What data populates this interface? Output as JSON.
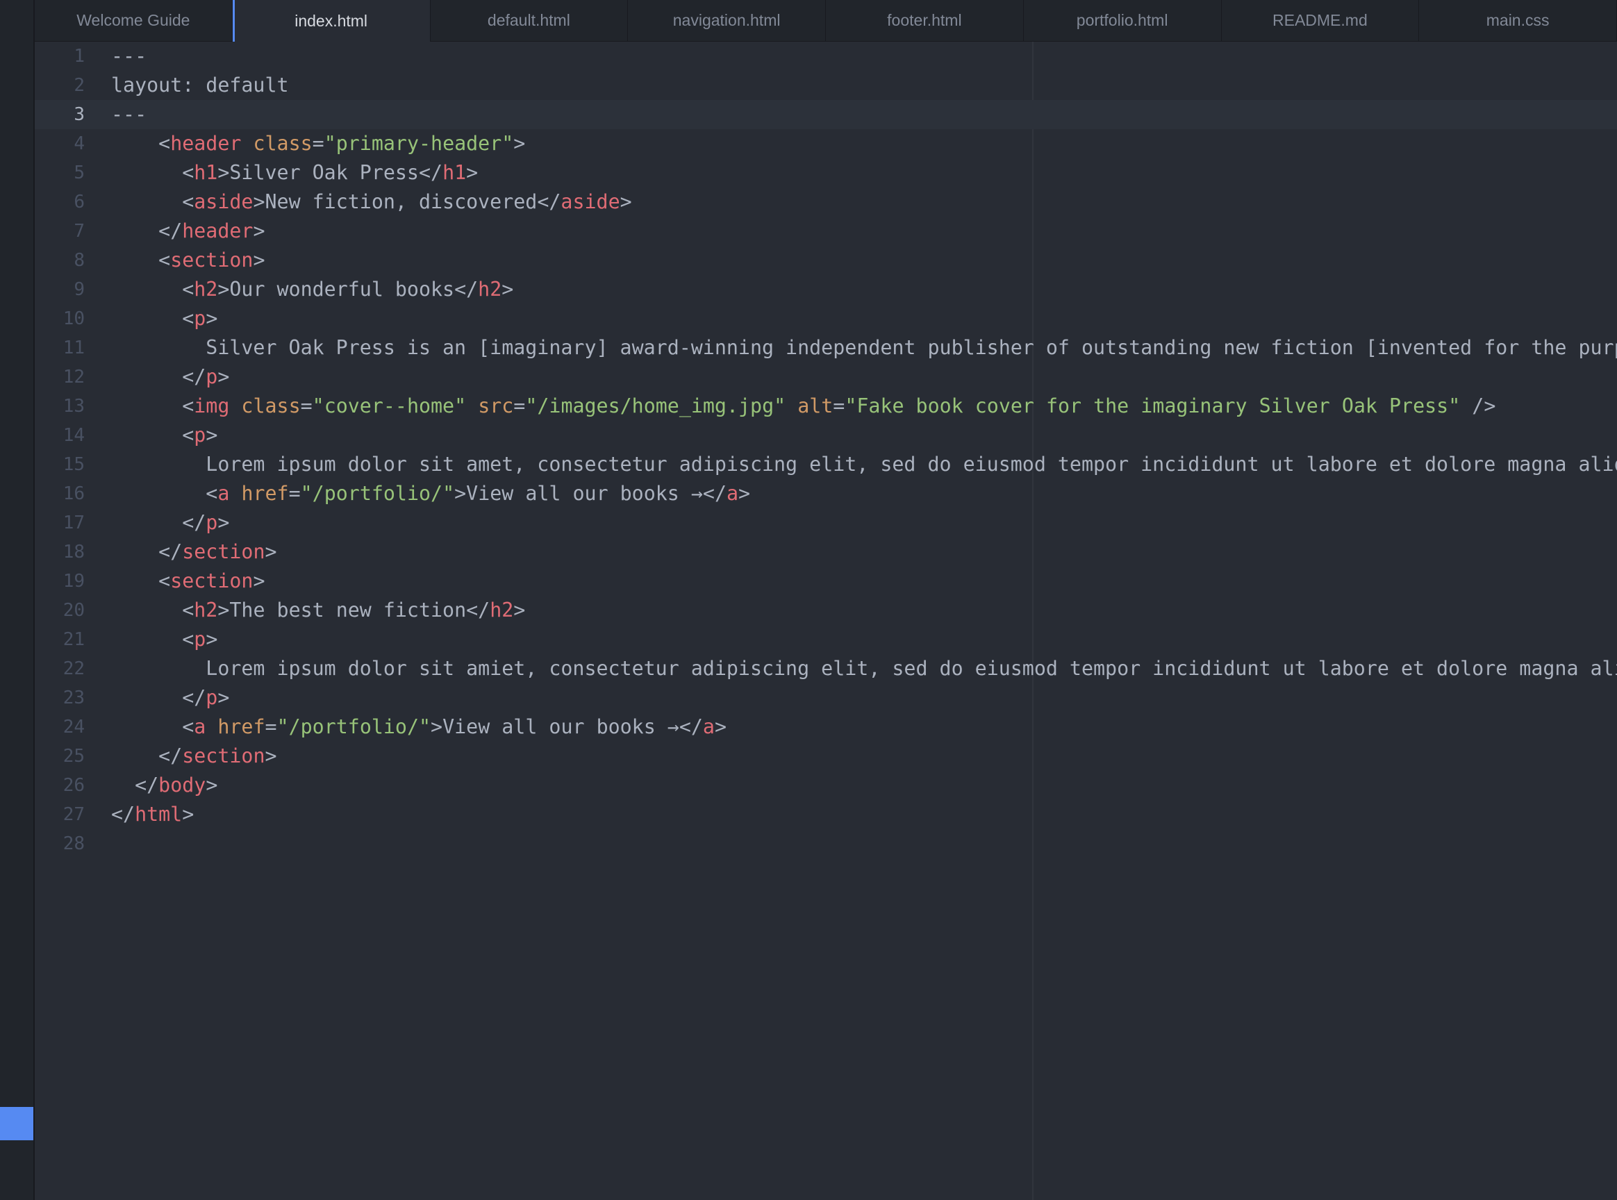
{
  "window": {
    "accent_color": "#568af2",
    "background_color": "#282c34"
  },
  "tabs": [
    {
      "label": "Welcome Guide",
      "active": false
    },
    {
      "label": "index.html",
      "active": true
    },
    {
      "label": "default.html",
      "active": false
    },
    {
      "label": "navigation.html",
      "active": false
    },
    {
      "label": "footer.html",
      "active": false
    },
    {
      "label": "portfolio.html",
      "active": false
    },
    {
      "label": "README.md",
      "active": false
    },
    {
      "label": "main.css",
      "active": false
    }
  ],
  "editor": {
    "cursor_line": 3,
    "lines": [
      {
        "num": "1",
        "tokens": [
          [
            "dash",
            "---"
          ]
        ]
      },
      {
        "num": "2",
        "tokens": [
          [
            "text",
            "layout: default"
          ]
        ]
      },
      {
        "num": "3",
        "tokens": [
          [
            "dash",
            "---"
          ]
        ]
      },
      {
        "num": "4",
        "tokens": [
          [
            "text",
            "    "
          ],
          [
            "punct",
            "<"
          ],
          [
            "tag",
            "header"
          ],
          [
            "text",
            " "
          ],
          [
            "attr",
            "class"
          ],
          [
            "punct",
            "="
          ],
          [
            "str",
            "\"primary-header\""
          ],
          [
            "punct",
            ">"
          ]
        ]
      },
      {
        "num": "5",
        "tokens": [
          [
            "text",
            "      "
          ],
          [
            "punct",
            "<"
          ],
          [
            "tag",
            "h1"
          ],
          [
            "punct",
            ">"
          ],
          [
            "text",
            "Silver Oak Press"
          ],
          [
            "punct",
            "</"
          ],
          [
            "tag",
            "h1"
          ],
          [
            "punct",
            ">"
          ]
        ]
      },
      {
        "num": "6",
        "tokens": [
          [
            "text",
            "      "
          ],
          [
            "punct",
            "<"
          ],
          [
            "tag",
            "aside"
          ],
          [
            "punct",
            ">"
          ],
          [
            "text",
            "New fiction, discovered"
          ],
          [
            "punct",
            "</"
          ],
          [
            "tag",
            "aside"
          ],
          [
            "punct",
            ">"
          ]
        ]
      },
      {
        "num": "7",
        "tokens": [
          [
            "text",
            "    "
          ],
          [
            "punct",
            "</"
          ],
          [
            "tag",
            "header"
          ],
          [
            "punct",
            ">"
          ]
        ]
      },
      {
        "num": "8",
        "tokens": [
          [
            "text",
            "    "
          ],
          [
            "punct",
            "<"
          ],
          [
            "tag",
            "section"
          ],
          [
            "punct",
            ">"
          ]
        ]
      },
      {
        "num": "9",
        "tokens": [
          [
            "text",
            "      "
          ],
          [
            "punct",
            "<"
          ],
          [
            "tag",
            "h2"
          ],
          [
            "punct",
            ">"
          ],
          [
            "text",
            "Our wonderful books"
          ],
          [
            "punct",
            "</"
          ],
          [
            "tag",
            "h2"
          ],
          [
            "punct",
            ">"
          ]
        ]
      },
      {
        "num": "10",
        "tokens": [
          [
            "text",
            "      "
          ],
          [
            "punct",
            "<"
          ],
          [
            "tag",
            "p"
          ],
          [
            "punct",
            ">"
          ]
        ]
      },
      {
        "num": "11",
        "tokens": [
          [
            "text",
            "        Silver Oak Press is an [imaginary] award-winning independent publisher of outstanding new fiction [invented for the purpos"
          ]
        ]
      },
      {
        "num": "12",
        "tokens": [
          [
            "text",
            "      "
          ],
          [
            "punct",
            "</"
          ],
          [
            "tag",
            "p"
          ],
          [
            "punct",
            ">"
          ]
        ]
      },
      {
        "num": "13",
        "tokens": [
          [
            "text",
            "      "
          ],
          [
            "punct",
            "<"
          ],
          [
            "tag",
            "img"
          ],
          [
            "text",
            " "
          ],
          [
            "attr",
            "class"
          ],
          [
            "punct",
            "="
          ],
          [
            "str",
            "\"cover--home\""
          ],
          [
            "text",
            " "
          ],
          [
            "attr",
            "src"
          ],
          [
            "punct",
            "="
          ],
          [
            "str",
            "\"/images/home_img.jpg\""
          ],
          [
            "text",
            " "
          ],
          [
            "attr",
            "alt"
          ],
          [
            "punct",
            "="
          ],
          [
            "str",
            "\"Fake book cover for the imaginary Silver Oak Press\""
          ],
          [
            "text",
            " "
          ],
          [
            "punct",
            "/>"
          ]
        ]
      },
      {
        "num": "14",
        "tokens": [
          [
            "text",
            "      "
          ],
          [
            "punct",
            "<"
          ],
          [
            "tag",
            "p"
          ],
          [
            "punct",
            ">"
          ]
        ]
      },
      {
        "num": "15",
        "tokens": [
          [
            "text",
            "        Lorem ipsum dolor sit amet, consectetur adipiscing elit, sed do eiusmod tempor incididunt ut labore et dolore magna aliqua"
          ]
        ]
      },
      {
        "num": "16",
        "tokens": [
          [
            "text",
            "        "
          ],
          [
            "punct",
            "<"
          ],
          [
            "tag",
            "a"
          ],
          [
            "text",
            " "
          ],
          [
            "attr",
            "href"
          ],
          [
            "punct",
            "="
          ],
          [
            "str",
            "\"/portfolio/\""
          ],
          [
            "punct",
            ">"
          ],
          [
            "text",
            "View all our books →"
          ],
          [
            "punct",
            "</"
          ],
          [
            "tag",
            "a"
          ],
          [
            "punct",
            ">"
          ]
        ]
      },
      {
        "num": "17",
        "tokens": [
          [
            "text",
            "      "
          ],
          [
            "punct",
            "</"
          ],
          [
            "tag",
            "p"
          ],
          [
            "punct",
            ">"
          ]
        ]
      },
      {
        "num": "18",
        "tokens": [
          [
            "text",
            "    "
          ],
          [
            "punct",
            "</"
          ],
          [
            "tag",
            "section"
          ],
          [
            "punct",
            ">"
          ]
        ]
      },
      {
        "num": "19",
        "tokens": [
          [
            "text",
            "    "
          ],
          [
            "punct",
            "<"
          ],
          [
            "tag",
            "section"
          ],
          [
            "punct",
            ">"
          ]
        ]
      },
      {
        "num": "20",
        "tokens": [
          [
            "text",
            "      "
          ],
          [
            "punct",
            "<"
          ],
          [
            "tag",
            "h2"
          ],
          [
            "punct",
            ">"
          ],
          [
            "text",
            "The best new fiction"
          ],
          [
            "punct",
            "</"
          ],
          [
            "tag",
            "h2"
          ],
          [
            "punct",
            ">"
          ]
        ]
      },
      {
        "num": "21",
        "tokens": [
          [
            "text",
            "      "
          ],
          [
            "punct",
            "<"
          ],
          [
            "tag",
            "p"
          ],
          [
            "punct",
            ">"
          ]
        ]
      },
      {
        "num": "22",
        "tokens": [
          [
            "text",
            "        Lorem ipsum dolor sit amiet, consectetur adipiscing elit, sed do eiusmod tempor incididunt ut labore et dolore magna aliqu"
          ]
        ]
      },
      {
        "num": "23",
        "tokens": [
          [
            "text",
            "      "
          ],
          [
            "punct",
            "</"
          ],
          [
            "tag",
            "p"
          ],
          [
            "punct",
            ">"
          ]
        ]
      },
      {
        "num": "24",
        "tokens": [
          [
            "text",
            "      "
          ],
          [
            "punct",
            "<"
          ],
          [
            "tag",
            "a"
          ],
          [
            "text",
            " "
          ],
          [
            "attr",
            "href"
          ],
          [
            "punct",
            "="
          ],
          [
            "str",
            "\"/portfolio/\""
          ],
          [
            "punct",
            ">"
          ],
          [
            "text",
            "View all our books →"
          ],
          [
            "punct",
            "</"
          ],
          [
            "tag",
            "a"
          ],
          [
            "punct",
            ">"
          ]
        ]
      },
      {
        "num": "25",
        "tokens": [
          [
            "text",
            "    "
          ],
          [
            "punct",
            "</"
          ],
          [
            "tag",
            "section"
          ],
          [
            "punct",
            ">"
          ]
        ]
      },
      {
        "num": "26",
        "tokens": [
          [
            "text",
            "  "
          ],
          [
            "punct",
            "</"
          ],
          [
            "tag",
            "body"
          ],
          [
            "punct",
            ">"
          ]
        ]
      },
      {
        "num": "27",
        "tokens": [
          [
            "punct",
            "</"
          ],
          [
            "tag",
            "html"
          ],
          [
            "punct",
            ">"
          ]
        ]
      },
      {
        "num": "28",
        "tokens": []
      }
    ]
  }
}
